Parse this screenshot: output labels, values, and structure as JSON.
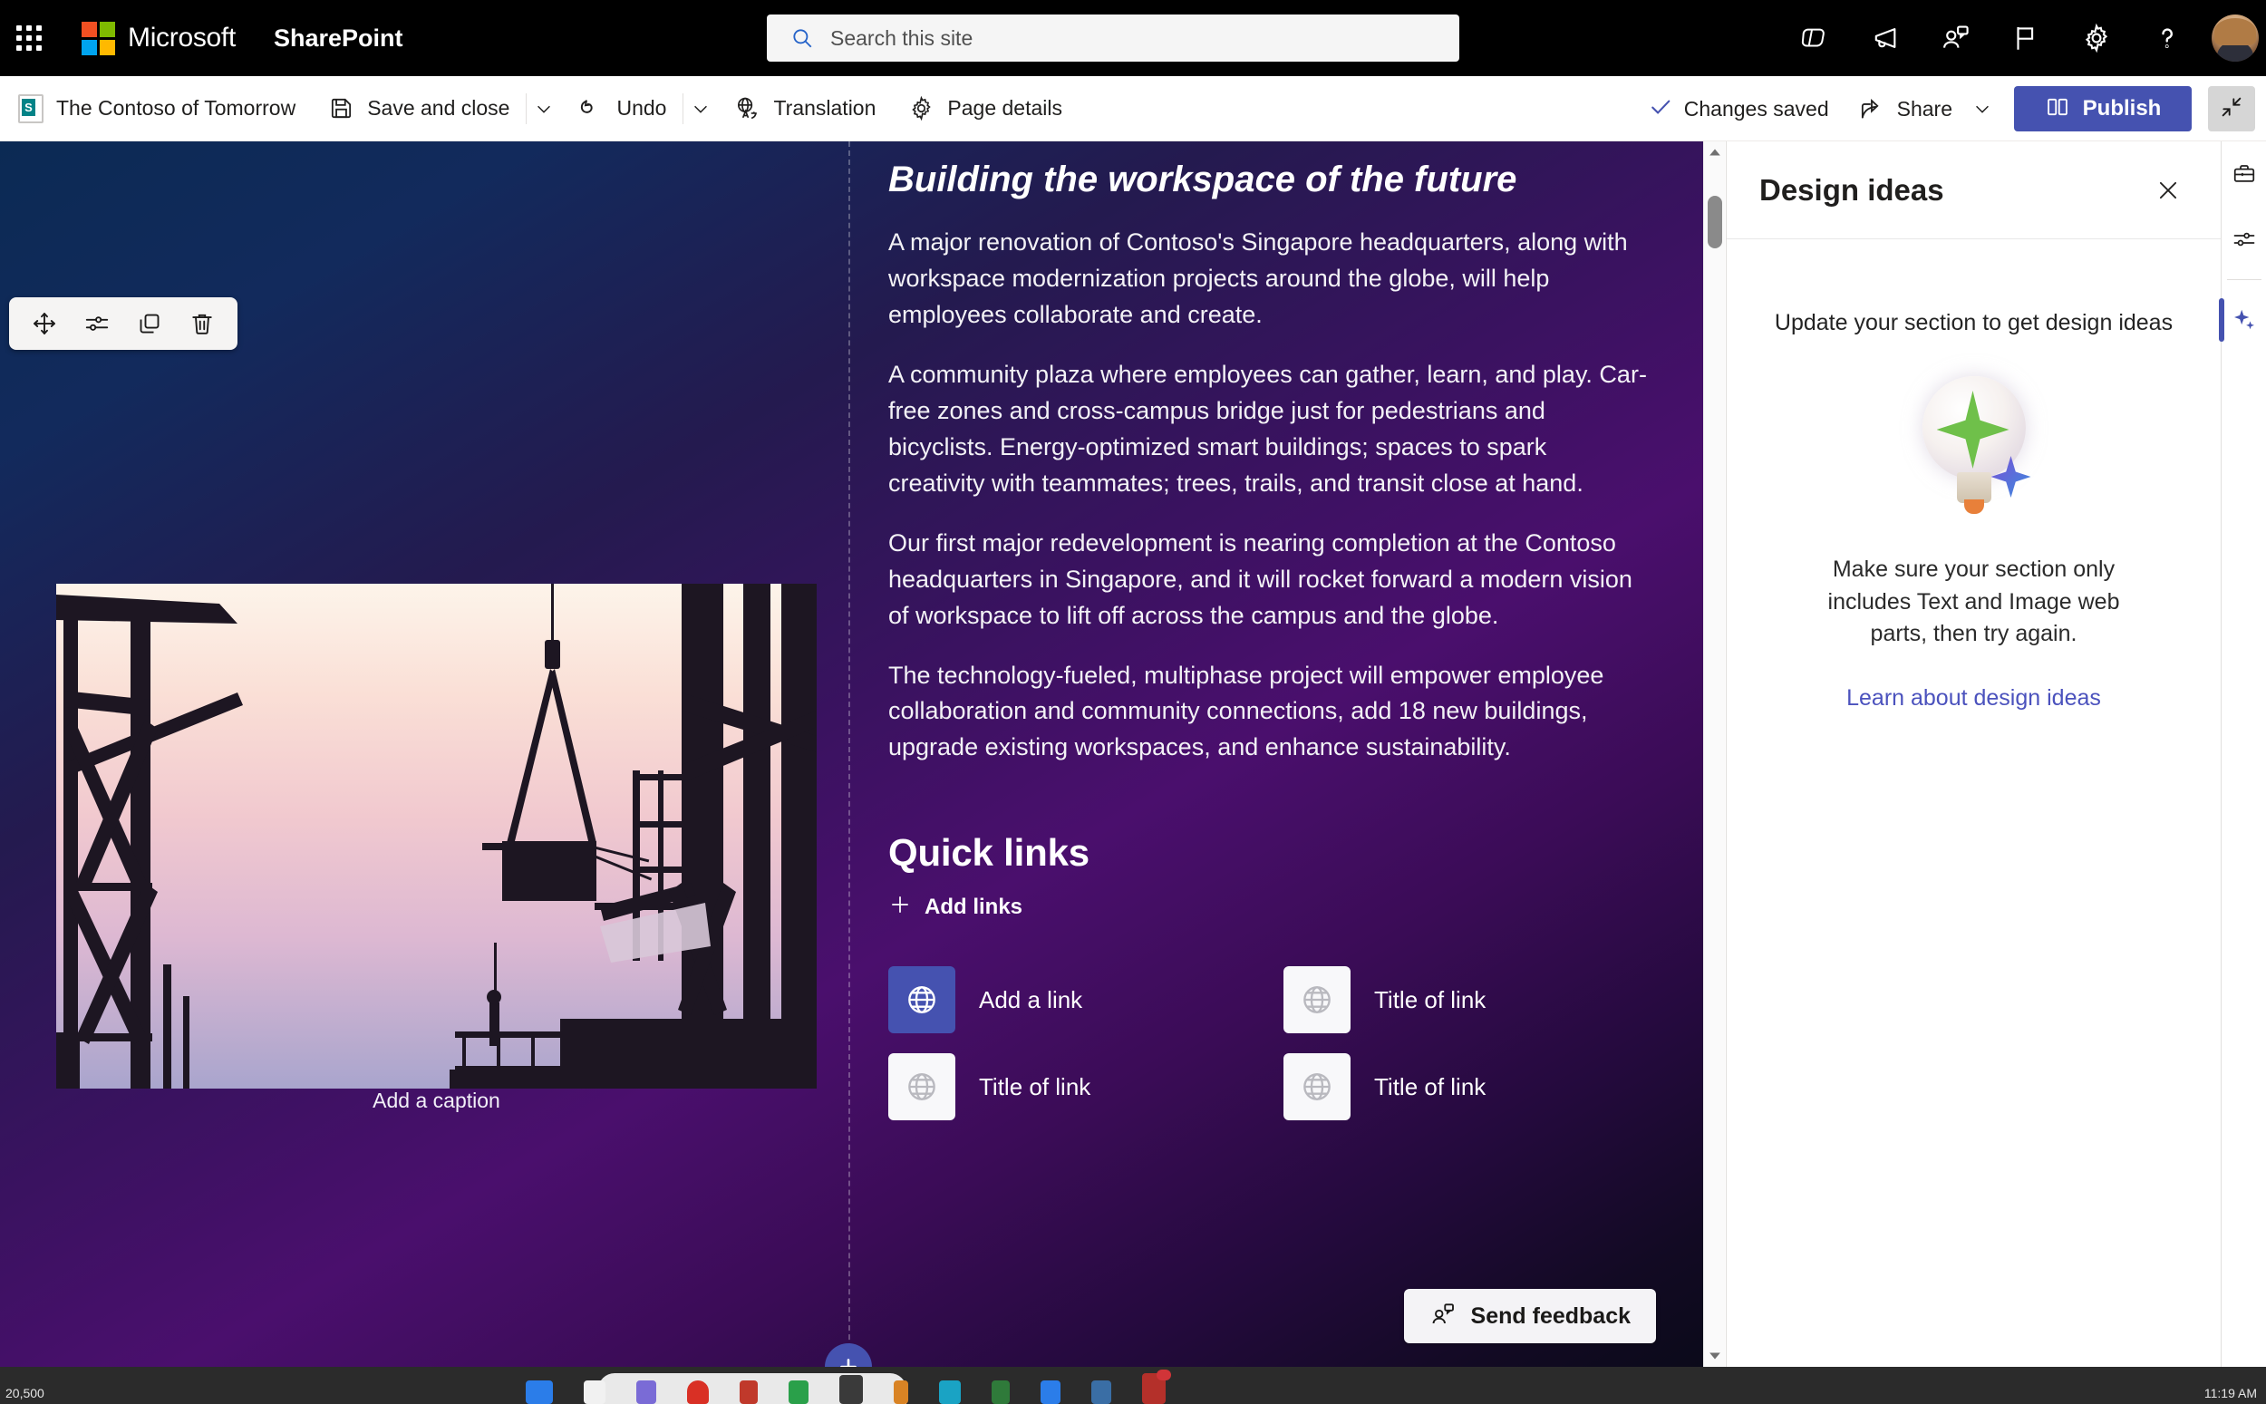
{
  "suitebar": {
    "waffle_label": "App launcher",
    "brand": "Microsoft",
    "app_name": "SharePoint",
    "search": {
      "placeholder": "Search this site",
      "value": ""
    },
    "actions": [
      {
        "name": "copilot-icon",
        "label": "Copilot"
      },
      {
        "name": "megaphone-icon",
        "label": "Announcements"
      },
      {
        "name": "feedback-person-icon",
        "label": "Give feedback"
      },
      {
        "name": "flag-icon",
        "label": "What's new"
      },
      {
        "name": "gear-icon",
        "label": "Settings"
      },
      {
        "name": "help-icon",
        "label": "Help"
      }
    ],
    "avatar_label": "Account manager"
  },
  "commandbar": {
    "page_title": "The Contoso of Tomorrow",
    "save_and_close": "Save and close",
    "undo": "Undo",
    "translation": "Translation",
    "page_details": "Page details",
    "changes_saved": "Changes saved",
    "share": "Share",
    "publish": "Publish",
    "collapse_label": "Exit full screen"
  },
  "webpart_toolbar": {
    "move": "Move web part",
    "edit": "Edit web part",
    "duplicate": "Duplicate web part",
    "delete": "Delete web part"
  },
  "content": {
    "heading": "Building the workspace of the future",
    "paragraphs": [
      "A major renovation of Contoso's Singapore headquarters, along with workspace modernization projects around the globe, will help employees collaborate and create.",
      "A community plaza where employees can gather, learn, and play. Car-free zones and cross-campus bridge just for pedestrians and bicyclists. Energy-optimized smart buildings; spaces to spark creativity with teammates; trees, trails, and transit close at hand.",
      "Our first major redevelopment is nearing completion at the Contoso headquarters in Singapore, and it will rocket forward a modern vision of workspace to lift off across the campus and the globe.",
      "The technology-fueled, multiphase project will empower employee collaboration and community connections, add 18 new buildings, upgrade existing workspaces, and enhance sustainability."
    ],
    "image_caption": "Add a caption",
    "image_alt": "Construction site silhouette at sunset with crane lifting materials"
  },
  "quicklinks": {
    "title": "Quick links",
    "add_links": "Add links",
    "items": [
      {
        "label": "Add a link",
        "icon": "globe-icon",
        "active": true
      },
      {
        "label": "Title of link",
        "icon": "globe-icon",
        "active": false
      },
      {
        "label": "Title of link",
        "icon": "globe-icon",
        "active": false
      },
      {
        "label": "Title of link",
        "icon": "globe-icon",
        "active": false
      }
    ]
  },
  "feedback": {
    "label": "Send feedback"
  },
  "add_section": {
    "label": "Add a new section"
  },
  "panel": {
    "title": "Design ideas",
    "close_label": "Close",
    "message": "Update your section to get design ideas",
    "submessage": "Make sure your section only includes Text and Image web parts, then try again.",
    "link": "Learn about design ideas",
    "illustration": "lightbulb-sparkle-icon"
  },
  "rail": {
    "items": [
      {
        "name": "toolbox-icon",
        "label": "Toolbox",
        "selected": false
      },
      {
        "name": "sliders-icon",
        "label": "Properties",
        "selected": false
      },
      {
        "name": "sparkle-icon",
        "label": "Design ideas",
        "selected": true
      }
    ]
  },
  "taskbar": {
    "left_text": "20,500",
    "clock": "11:19 AM"
  },
  "colors": {
    "accent": "#4552b0",
    "suitebar_bg": "#000000",
    "link": "#4b52bd",
    "canvas_start": "#0b2a54",
    "canvas_end": "#0b0a1a"
  }
}
